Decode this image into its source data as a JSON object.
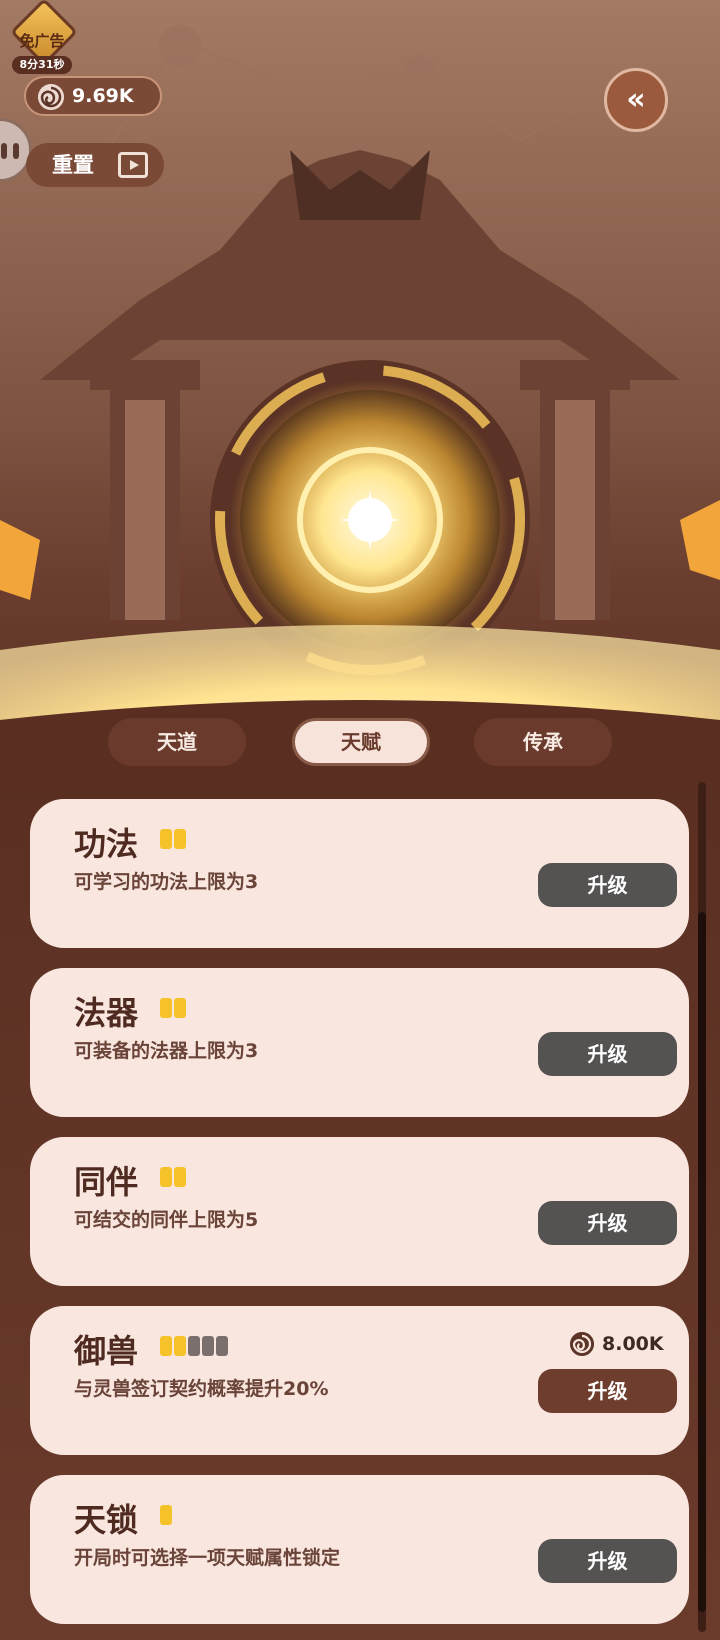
{
  "top_left": {
    "noad_label": "免广告",
    "noad_timer": "8分31秒",
    "currency_value": "9.69K",
    "reset_label": "重置"
  },
  "tabs": [
    {
      "label": "天道",
      "active": false
    },
    {
      "label": "天赋",
      "active": true
    },
    {
      "label": "传承",
      "active": false
    }
  ],
  "cards": [
    {
      "title": "功法",
      "desc": "可学习的功法上限为3",
      "pips_on": 2,
      "pips_off": 0,
      "button": "升级",
      "cost": null
    },
    {
      "title": "法器",
      "desc": "可装备的法器上限为3",
      "pips_on": 2,
      "pips_off": 0,
      "button": "升级",
      "cost": null
    },
    {
      "title": "同伴",
      "desc": "可结交的同伴上限为5",
      "pips_on": 2,
      "pips_off": 0,
      "button": "升级",
      "cost": null
    },
    {
      "title": "御兽",
      "desc": "与灵兽签订契约概率提升20%",
      "pips_on": 2,
      "pips_off": 3,
      "button": "升级",
      "cost": "8.00K"
    },
    {
      "title": "天锁",
      "desc": "开局时可选择一项天赋属性锁定",
      "pips_on": 1,
      "pips_off": 0,
      "button": "升级",
      "cost": null
    }
  ],
  "colors": {
    "accent_gold": "#f5c229",
    "button_disabled": "#555252",
    "button_available": "#6e3d2d",
    "card_bg": "#f8e6df"
  },
  "icons": {
    "currency": "spiral-coin-icon",
    "back": "double-chevron-left-icon",
    "video": "video-play-icon"
  }
}
